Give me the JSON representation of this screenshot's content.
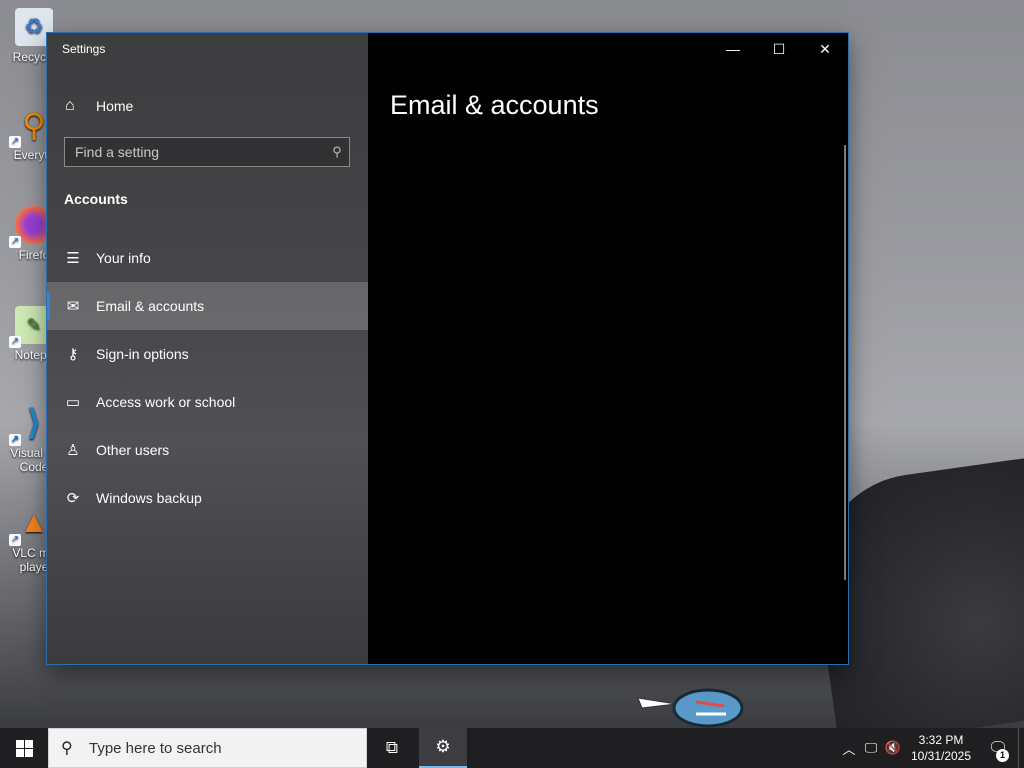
{
  "desktop": {
    "icons": [
      {
        "label": "Recycle",
        "icon": "recycle-bin-icon"
      },
      {
        "label": "Everyth",
        "icon": "everything-search-icon"
      },
      {
        "label": "Firefo",
        "icon": "firefox-icon"
      },
      {
        "label": "Notepa",
        "icon": "notepad-plus-plus-icon"
      },
      {
        "label": "Visual St Code",
        "icon": "vscode-icon"
      },
      {
        "label": "VLC mo playe",
        "icon": "vlc-icon"
      }
    ]
  },
  "window": {
    "app_title": "Settings",
    "controls": {
      "minimize": "—",
      "maximize": "☐",
      "close": "✕"
    }
  },
  "nav": {
    "home_label": "Home",
    "search_placeholder": "Find a setting",
    "section_title": "Accounts",
    "items": [
      {
        "label": "Your info",
        "icon": "person-card-icon",
        "selected": false
      },
      {
        "label": "Email & accounts",
        "icon": "mail-icon",
        "selected": true
      },
      {
        "label": "Sign-in options",
        "icon": "key-icon",
        "selected": false
      },
      {
        "label": "Access work or school",
        "icon": "briefcase-icon",
        "selected": false
      },
      {
        "label": "Other users",
        "icon": "person-add-icon",
        "selected": false
      },
      {
        "label": "Windows backup",
        "icon": "sync-icon",
        "selected": false
      }
    ]
  },
  "content": {
    "page_title": "Email & accounts"
  },
  "taskbar": {
    "search_text": "Type here to search",
    "time": "3:32 PM",
    "date": "10/31/2025",
    "notification_count": "1"
  },
  "colors": {
    "accent": "#3b7fcf",
    "window_border": "#2a6fb2",
    "taskbar": "#1f1f22"
  }
}
